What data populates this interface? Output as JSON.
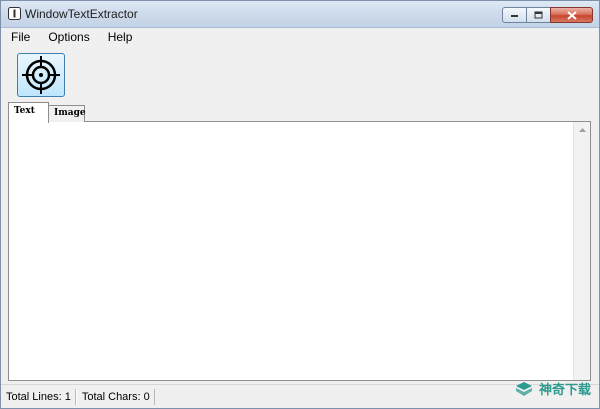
{
  "window": {
    "title": "WindowTextExtractor"
  },
  "menu": {
    "items": [
      "File",
      "Options",
      "Help"
    ]
  },
  "toolbar": {
    "target_icon": "crosshair-target-icon"
  },
  "tabs": [
    {
      "label": "Text",
      "active": true
    },
    {
      "label": "Image",
      "active": false
    }
  ],
  "text_area": {
    "value": ""
  },
  "status": {
    "total_lines": "Total Lines: 1",
    "total_chars": "Total Chars: 0"
  },
  "watermark": {
    "text": "神奇下载"
  },
  "colors": {
    "titlebar": "#cfdcec",
    "close_button": "#c7462f",
    "target_button_border": "#3c7fb1",
    "watermark": "#2d9a8f"
  }
}
